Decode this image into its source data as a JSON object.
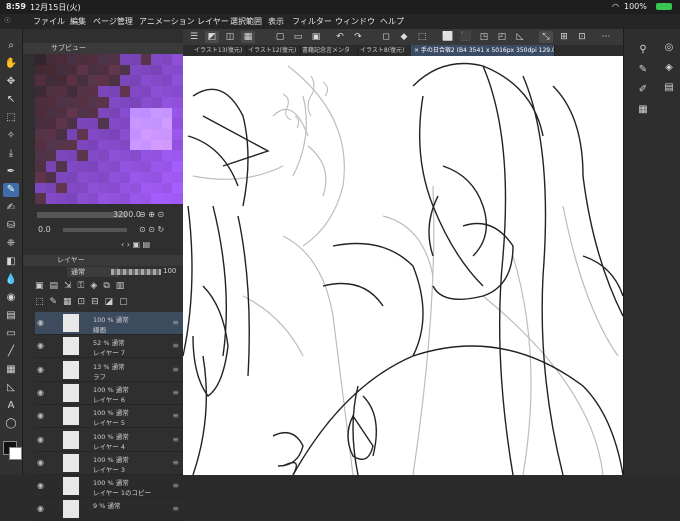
{
  "status_bar": {
    "time": "8:59",
    "date": "12月15日(火)",
    "battery": "100%"
  },
  "menu": [
    "ファイル",
    "編集",
    "ページ管理",
    "アニメーション",
    "レイヤー",
    "選択範囲",
    "表示",
    "フィルター",
    "ウィンドウ",
    "ヘルプ"
  ],
  "navigator": {
    "title": "サブビュー",
    "zoom": "3200.0",
    "rotation": "0.0"
  },
  "layer_panel": {
    "title": "レイヤー",
    "blend_mode": "通常",
    "opacity": "100",
    "layers": [
      {
        "line1": "100 % 通常",
        "line2": "線画",
        "selected": true
      },
      {
        "line1": "52 % 通常",
        "line2": "レイヤー 7",
        "selected": false
      },
      {
        "line1": "13 % 通常",
        "line2": "ラフ",
        "selected": false
      },
      {
        "line1": "100 % 通常",
        "line2": "レイヤー 6",
        "selected": false
      },
      {
        "line1": "100 % 通常",
        "line2": "レイヤー 5",
        "selected": false
      },
      {
        "line1": "100 % 通常",
        "line2": "レイヤー 4",
        "selected": false
      },
      {
        "line1": "100 % 通常",
        "line2": "レイヤー 3",
        "selected": false
      },
      {
        "line1": "100 % 通常",
        "line2": "レイヤー 1のコピー",
        "selected": false
      },
      {
        "line1": "9 % 通常",
        "line2": "",
        "selected": false
      }
    ]
  },
  "tabs": [
    {
      "label": "イラスト13(復元)",
      "active": false
    },
    {
      "label": "イラスト12(復元)",
      "active": false
    },
    {
      "label": "書籍記念言メンタ",
      "active": false
    },
    {
      "label": "イラスト8(復元)",
      "active": false
    },
    {
      "label": "× 手の日合宿2 (B4 3541 x 5016px 350dpi 129.0%)",
      "active": true
    }
  ],
  "colors": {
    "accent": "#3f6ea8",
    "navigator_purple": "#6a3fb0"
  }
}
